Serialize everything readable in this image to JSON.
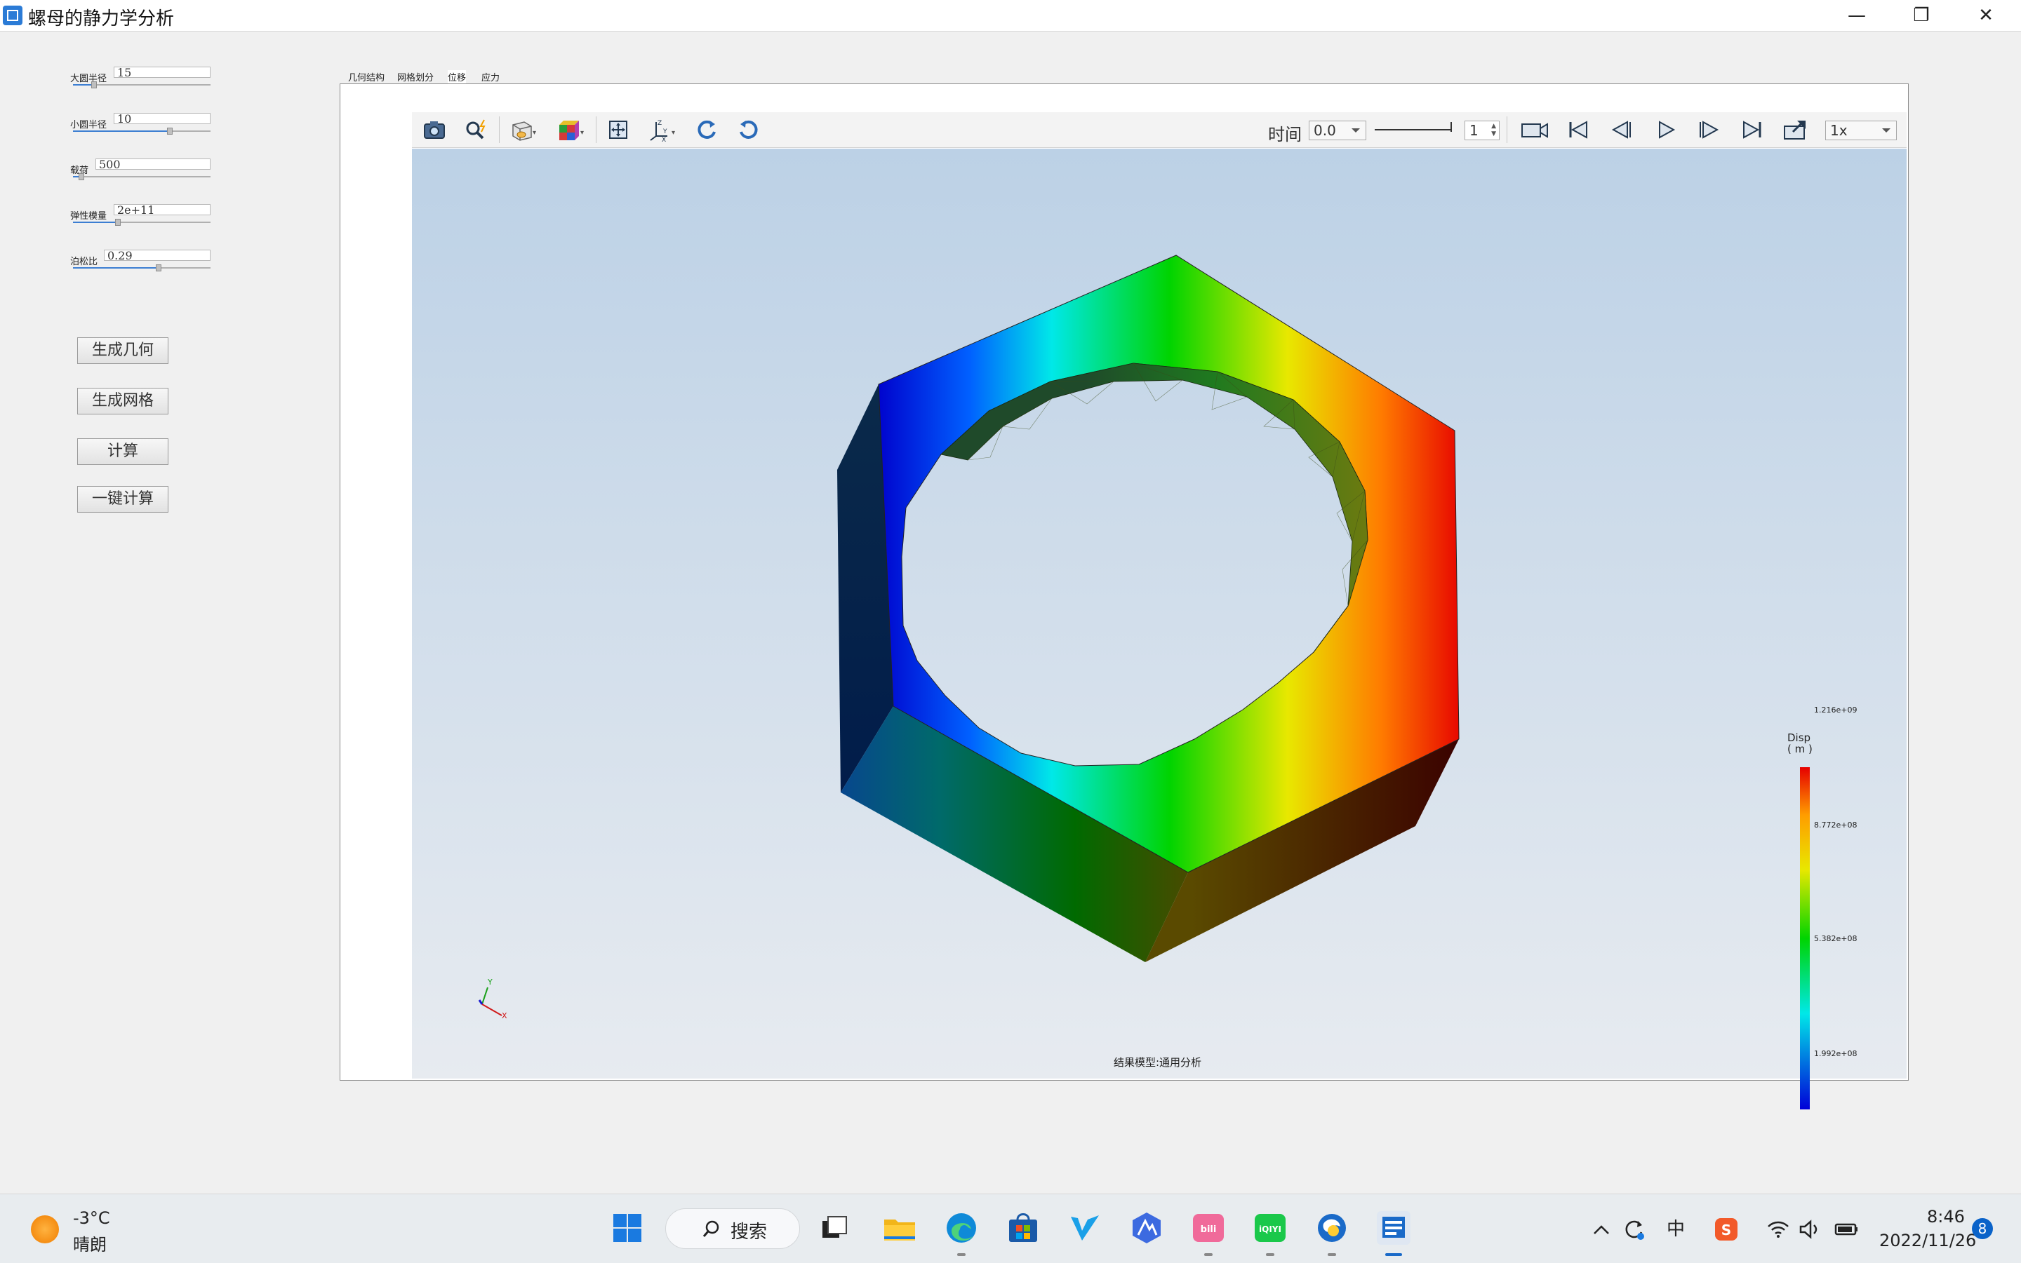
{
  "window": {
    "title": "螺母的静力学分析",
    "minimize_glyph": "—",
    "restore_glyph": "❐",
    "close_glyph": "✕"
  },
  "params": [
    {
      "label": "大圆半径",
      "value": "15",
      "slider_fraction": 0.08
    },
    {
      "label": "小圆半径",
      "value": "10",
      "slider_fraction": 0.72
    },
    {
      "label": "载荷",
      "value": "500",
      "slider_fraction": 0.04
    },
    {
      "label": "弹性模量",
      "value": "2e+11",
      "slider_fraction": 0.32
    },
    {
      "label": "泊松比",
      "value": "0.29",
      "slider_fraction": 0.62
    }
  ],
  "actions": [
    "生成几何",
    "生成网格",
    "计算",
    "一键计算"
  ],
  "tabs": [
    "几何结构",
    "网格划分",
    "位移",
    "应力"
  ],
  "active_tab": "位移",
  "toolbar": {
    "time_label": "时间",
    "time_value": "0.0",
    "frame_value": "1",
    "speed_value": "1x",
    "icons": [
      "camera-icon",
      "magnifier-icon",
      "wireframe-icon",
      "color-cube-icon",
      "fit-view-icon",
      "axes-icon",
      "rotate-cw-icon",
      "rotate-ccw-icon",
      "record-icon",
      "first-frame-icon",
      "prev-frame-icon",
      "play-icon",
      "next-frame-icon",
      "last-frame-icon",
      "export-icon"
    ]
  },
  "viewer": {
    "model_label": "结果模型:通用分析",
    "legend": {
      "title": "Disp",
      "unit": "( m )",
      "ticks": [
        "1.216e+09",
        "8.772e+08",
        "5.382e+08",
        "1.992e+08"
      ],
      "colors": [
        "#e60000",
        "#e8e800",
        "#00d400",
        "#00e8e8",
        "#0000d8"
      ]
    },
    "triad_labels": [
      "Y",
      "X"
    ]
  },
  "taskbar": {
    "weather_temp": "-3°C",
    "weather_desc": "晴朗",
    "search_label": "搜索",
    "time": "8:46",
    "date": "2022/11/26",
    "notification_count": "8",
    "ime_label": "中",
    "apps": [
      "start-icon",
      "task-view-icon",
      "file-explorer-icon",
      "edge-icon",
      "store-icon",
      "app-v-icon",
      "app-a-icon",
      "bilibili-icon",
      "iqiyi-icon",
      "browser-icon",
      "fe-app-icon"
    ]
  }
}
